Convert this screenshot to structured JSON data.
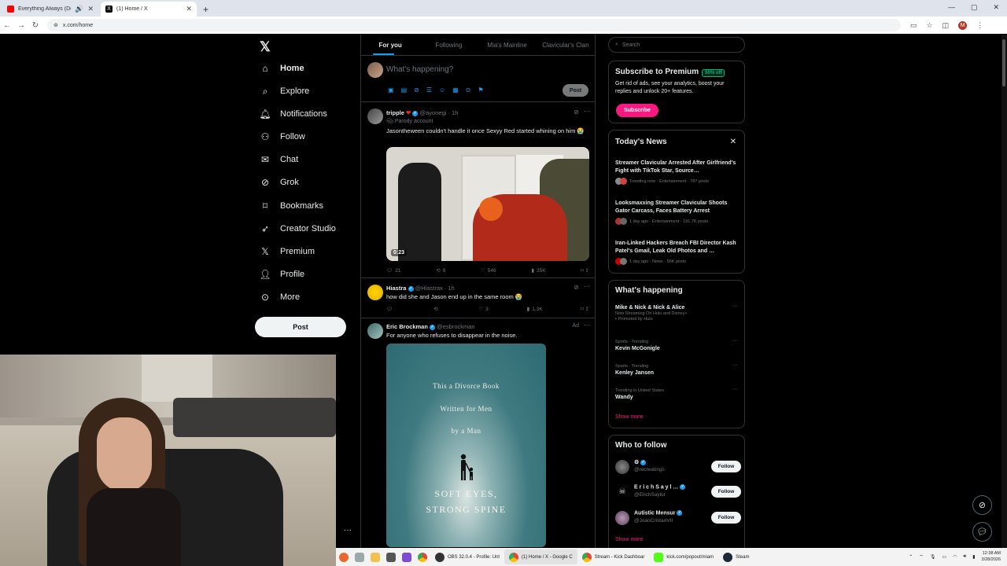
{
  "browser": {
    "tabs": [
      {
        "title": "Everything Always (Dom Do",
        "color": "#ff0000"
      },
      {
        "title": "(1) Home / X",
        "color": "#000000"
      }
    ],
    "url": "x.com/home"
  },
  "nav": {
    "logo": "𝕏",
    "items": [
      {
        "label": "Home",
        "icon": "home-icon"
      },
      {
        "label": "Explore",
        "icon": "search-icon"
      },
      {
        "label": "Notifications",
        "icon": "bell-icon"
      },
      {
        "label": "Follow",
        "icon": "person-add-icon"
      },
      {
        "label": "Chat",
        "icon": "mail-icon"
      },
      {
        "label": "Grok",
        "icon": "grok-icon"
      },
      {
        "label": "Bookmarks",
        "icon": "bookmark-icon"
      },
      {
        "label": "Creator Studio",
        "icon": "rocket-icon"
      },
      {
        "label": "Premium",
        "icon": "x-icon"
      },
      {
        "label": "Profile",
        "icon": "person-icon"
      },
      {
        "label": "More",
        "icon": "more-circle-icon"
      }
    ],
    "post_label": "Post"
  },
  "feed": {
    "tabs": [
      "For you",
      "Following",
      "Mia's Mainline",
      "Clavicular's Clan"
    ],
    "compose_placeholder": "What's happening?",
    "compose_post": "Post",
    "tweets": [
      {
        "name": "tripple",
        "handle": "@ayonegi · 1h",
        "sub": "Parody account",
        "text": "Jasontheween couldn't handle it once Sexyy Red started whining on him 😭",
        "media_time": "0:23",
        "replies": "21",
        "reposts": "9",
        "likes": "546",
        "views": "35K"
      },
      {
        "name": "Hiastra",
        "handle": "@Hiastrax · 1h",
        "text": "how did she and Jason end up in the same room 😭",
        "replies": "",
        "reposts": "",
        "likes": "3",
        "views": "1.3K"
      },
      {
        "name": "Eric Brockman",
        "handle": "@esbrockman",
        "ad": "Ad",
        "text": "For anyone who refuses to disappear in the noise.",
        "book_lines": [
          "This a Divorce Book",
          "Written for Men",
          "by a Man"
        ],
        "book_title_1": "SOFT EYES,",
        "book_title_2": "STRONG SPINE"
      }
    ]
  },
  "right": {
    "search_placeholder": "Search",
    "premium": {
      "title": "Subscribe to Premium",
      "badge": "50% off",
      "text": "Get rid of ads, see your analytics, boost your replies and unlock 20+ features.",
      "button": "Subscribe"
    },
    "news": {
      "title": "Today's News",
      "items": [
        {
          "title": "Streamer Clavicular Arrested After Girlfriend's Fight with TikTok Star, Source…",
          "meta": "Trending now · Entertainment · 787 posts"
        },
        {
          "title": "Looksmaxxing Streamer Clavicular Shoots Gator Carcass, Faces Battery Arrest",
          "meta": "1 day ago · Entertainment · 191.7K posts"
        },
        {
          "title": "Iran-Linked Hackers Breach FBI Director Kash Patel's Gmail, Leak Old Photos and …",
          "meta": "1 day ago · News · 56K posts"
        }
      ]
    },
    "happening": {
      "title": "What's happening",
      "items": [
        {
          "cat": "",
          "name": "Mike & Nick & Nick & Alice",
          "posts": "Now Streaming On Hulu and Disney+",
          "promo": "Promoted by Hulu"
        },
        {
          "cat": "Sports · Trending",
          "name": "Kevin McGonigle",
          "posts": "",
          "promo": ""
        },
        {
          "cat": "Sports · Trending",
          "name": "Kenley Jansen",
          "posts": "",
          "promo": ""
        },
        {
          "cat": "Trending in United States",
          "name": "Wandy",
          "posts": "",
          "promo": ""
        }
      ],
      "show_more": "Show more"
    },
    "who_to_follow": {
      "title": "Who to follow",
      "items": [
        {
          "name": "⚙",
          "handle": "@recreatings",
          "button": "Follow"
        },
        {
          "name": "E r i c h  S a y l …",
          "handle": "@ErichSaylor",
          "button": "Follow"
        },
        {
          "name": "Autistic Mensur",
          "handle": "@JoaoCristaoVII",
          "button": "Follow"
        }
      ],
      "show_more": "Show more"
    }
  },
  "taskbar": {
    "apps": [
      {
        "label": "OBS 32.0.4 - Profile: Unt"
      },
      {
        "label": "(1) Home / X - Google C"
      },
      {
        "label": "Stream - Kick Dashboar"
      },
      {
        "label": "kick.com/popout/miam"
      },
      {
        "label": "Steam"
      }
    ],
    "time": "12:38 AM",
    "date": "3/28/2026"
  },
  "colors": {
    "accent": "#1d9bf0",
    "pink": "#f91880",
    "bg": "#000000"
  }
}
